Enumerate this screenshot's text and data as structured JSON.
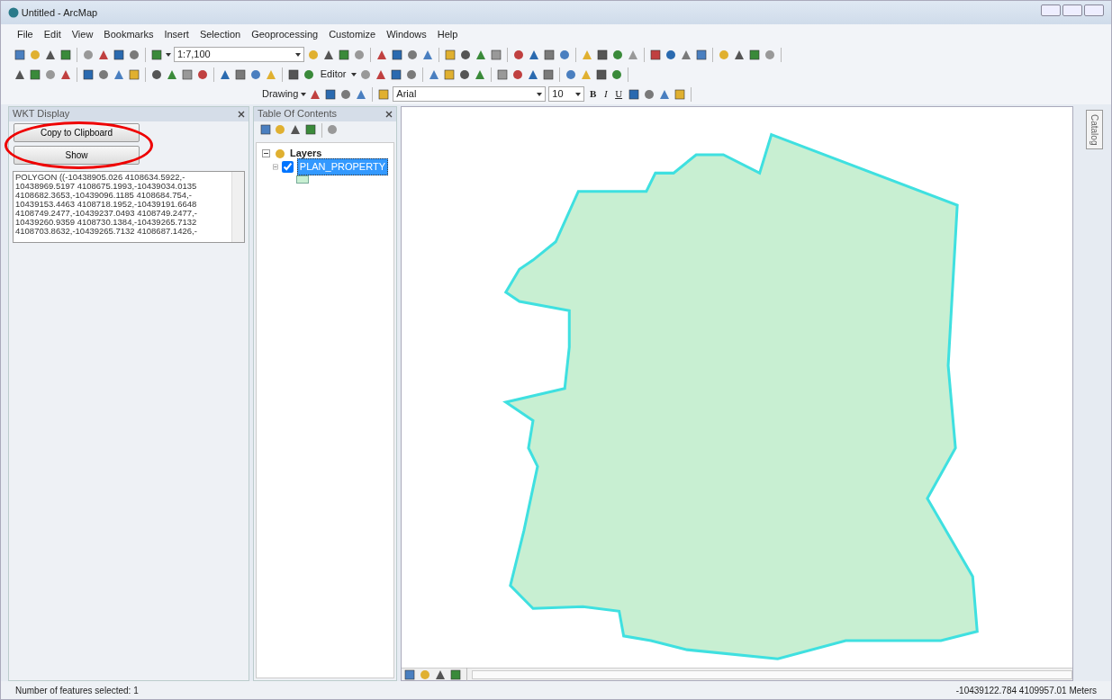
{
  "window": {
    "title": "Untitled - ArcMap"
  },
  "menu": [
    {
      "label": "File"
    },
    {
      "label": "Edit"
    },
    {
      "label": "View"
    },
    {
      "label": "Bookmarks"
    },
    {
      "label": "Insert"
    },
    {
      "label": "Selection"
    },
    {
      "label": "Geoprocessing"
    },
    {
      "label": "Customize"
    },
    {
      "label": "Windows"
    },
    {
      "label": "Help"
    }
  ],
  "toolbar": {
    "scale": "1:7,100",
    "editor": "Editor",
    "drawing": "Drawing",
    "font": "Arial",
    "font_size": "10",
    "bold": "B",
    "italic": "I",
    "underline": "U"
  },
  "wkt_panel": {
    "title": "WKT Display",
    "buttons": [
      "Copy to Clipboard",
      "Show"
    ],
    "lines": [
      "POLYGON ((-10438905.026 4108634.5922,-",
      "10438969.5197 4108675.1993,-10439034.0135",
      "4108682.3653,-10439096.1185 4108684.754,-",
      "10439153.4463 4108718.1952,-10439191.6648",
      "4108749.2477,-10439237.0493 4108749.2477,-",
      "10439260.9359 4108730.1384,-10439265.7132",
      "4108703.8632,-10439265.7132 4108687.1426,-"
    ]
  },
  "toc": {
    "title": "Table Of Contents",
    "tree": [
      {
        "label": "Layers",
        "expanded": true,
        "children": [
          {
            "label": "PLAN_PROPERTY",
            "expanded": true,
            "checked": true,
            "selected": true
          }
        ]
      }
    ]
  },
  "side_tab": {
    "label": "Catalog"
  },
  "status_bar": {
    "left": "Number of features selected: 1",
    "right": "-10439122.784  4109957.01 Meters"
  }
}
